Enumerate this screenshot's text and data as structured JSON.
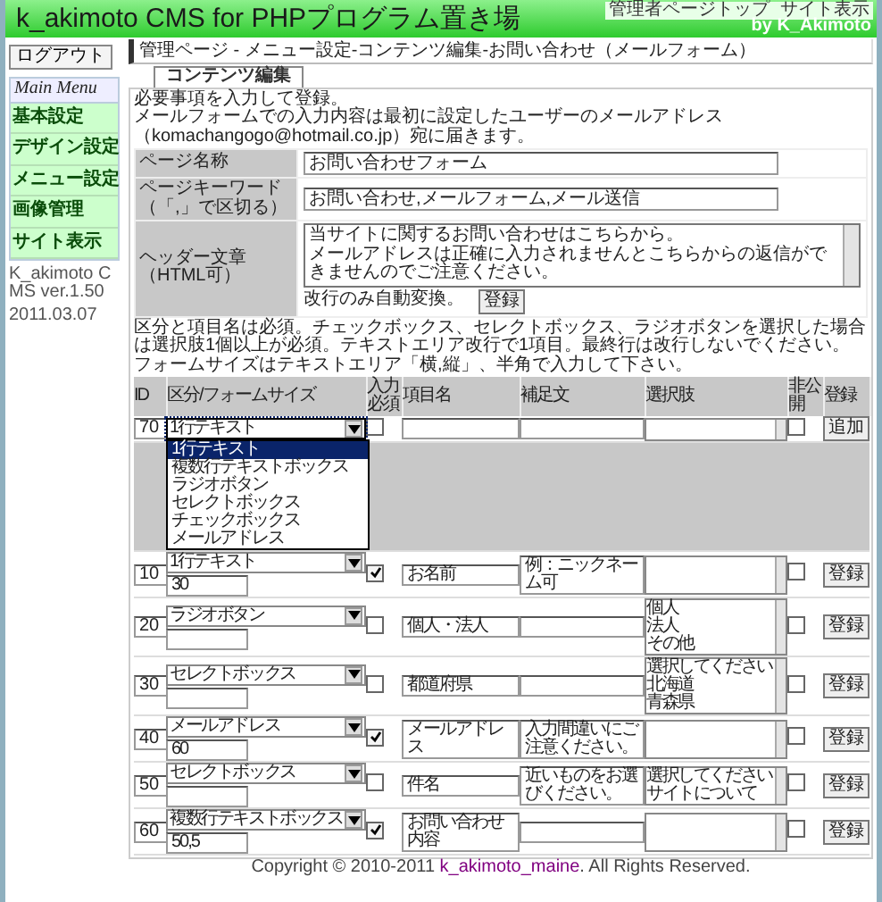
{
  "header": {
    "title": "k_akimoto CMS for PHPプログラム置き場",
    "links": [
      "管理者ページトップ",
      "サイト表示"
    ],
    "byline": "by K_Akimoto"
  },
  "sidebar": {
    "logout": "ログアウト",
    "menu_title": "Main Menu",
    "items": [
      "基本設定",
      "デザイン設定",
      "メニュー設定",
      "画像管理",
      "サイト表示"
    ],
    "version": "K_akimoto CMS ver.1.50",
    "date": "2011.03.07"
  },
  "heading": "管理ページ - メニュー設定-コンテンツ編集-お問い合わせ（メールフォーム）",
  "tabs": [
    {
      "label": "コンテンツ編集",
      "selected": true
    }
  ],
  "intro": [
    "必要事項を入力して登録。",
    "メールフォームでの入力内容は最初に設定したユーザーのメールアドレス（komachangogo@hotmail.co.jp）宛に届きます。"
  ],
  "page_form": {
    "rows": [
      {
        "label_lines": [
          "ページ名称"
        ],
        "value": "お問い合わせフォーム"
      },
      {
        "label_lines": [
          "ページキーワード",
          "（「,」で区切る）"
        ],
        "value": "お問い合わせ,メールフォーム,メール送信"
      }
    ],
    "header_text": {
      "label_lines": [
        "ヘッダー文章",
        "（HTML可）"
      ],
      "value_lines": [
        "当サイトに関するお問い合わせはこちらから。",
        "メールアドレスは正確に入力されませんとこちらからの返信ができませんのでご注意ください。"
      ],
      "note": "改行のみ自動変換。",
      "button": "登録"
    }
  },
  "notes": [
    "区分と項目名は必須。チェックボックス、セレクトボックス、ラジオボタンを選択した場合は選択肢1個以上が必須。テキストエリア改行で1項目。最終行は改行しないでください。",
    "フォームサイズはテキストエリア「横,縦」、半角で入力して下さい。"
  ],
  "form_table": {
    "columns": [
      "ID",
      "区分/フォームサイズ",
      "入力必須",
      "項目名",
      "補足文",
      "選択肢",
      "非公開",
      "登録"
    ],
    "new_row": {
      "id": "70",
      "type": "1行テキスト",
      "expanded": true,
      "required": false,
      "hidden": false,
      "button": "追加",
      "options": [
        {
          "label": "1行テキスト",
          "selected": true
        },
        {
          "label": "複数行テキストボックス",
          "selected": false
        },
        {
          "label": "ラジオボタン",
          "selected": false
        },
        {
          "label": "セレクトボックス",
          "selected": false
        },
        {
          "label": "チェックボックス",
          "selected": false
        },
        {
          "label": "メールアドレス",
          "selected": false
        }
      ]
    },
    "rows": [
      {
        "id": "10",
        "type": "1行テキスト",
        "size": "30",
        "required": true,
        "name": "お名前",
        "note": "例：ニックネーム可",
        "hidden": false,
        "button": "登録"
      },
      {
        "id": "20",
        "type": "ラジオボタン",
        "required": false,
        "name": "個人・法人",
        "choices": [
          "個人",
          "法人",
          "その他"
        ],
        "hidden": false,
        "button": "登録"
      },
      {
        "id": "30",
        "type": "セレクトボックス",
        "required": false,
        "name": "都道府県",
        "choices": [
          "選択してください",
          "北海道",
          "青森県"
        ],
        "hidden": false,
        "button": "登録"
      },
      {
        "id": "40",
        "type": "メールアドレス",
        "size": "60",
        "required": true,
        "name": "メールアドレス",
        "note": "入力間違いにご注意ください。",
        "hidden": false,
        "button": "登録"
      },
      {
        "id": "50",
        "type": "セレクトボックス",
        "required": false,
        "name": "件名",
        "note": "近いものをお選びください。",
        "choices": [
          "選択してください",
          "サイトについて"
        ],
        "hidden": false,
        "button": "登録"
      },
      {
        "id": "60",
        "type": "複数行テキストボックス",
        "size": "50,5",
        "required": true,
        "name": "お問い合わせ内容",
        "hidden": false,
        "button": "登録"
      }
    ]
  },
  "footer": {
    "before": "Copyright © 2010-2011 ",
    "link": "k_akimoto_maine",
    "after": ". All Rights Reserved."
  }
}
